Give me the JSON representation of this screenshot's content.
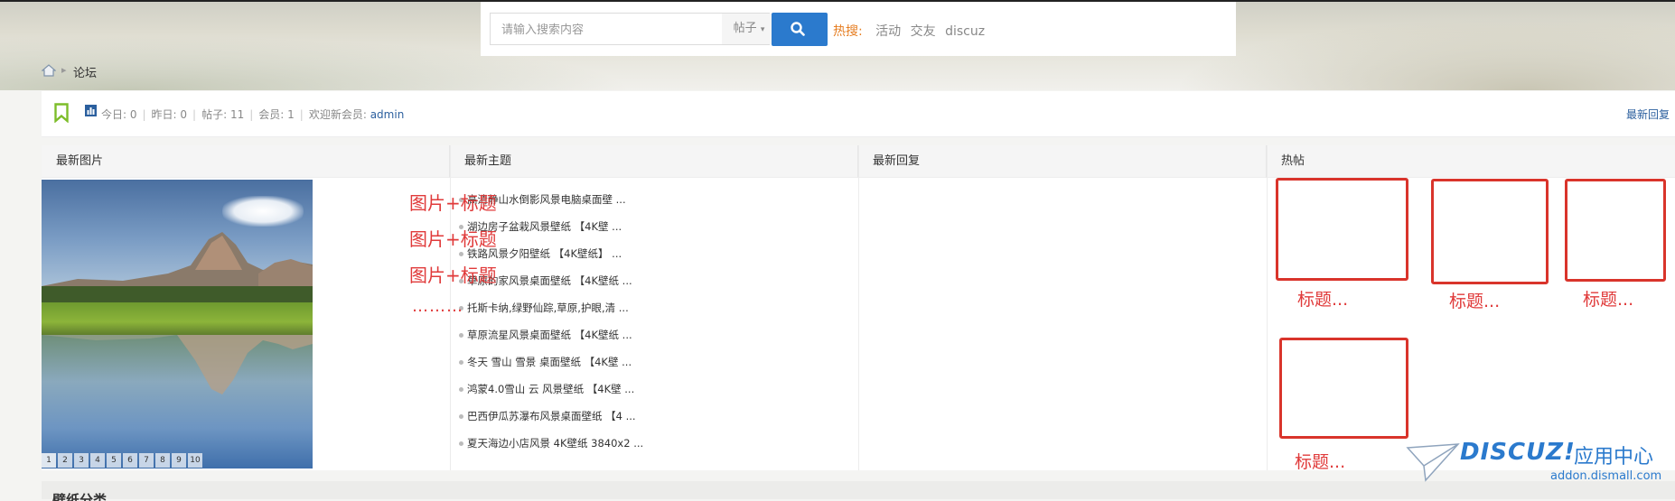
{
  "search": {
    "placeholder": "请输入搜索内容",
    "type_label": "帖子",
    "hot_label": "热搜:",
    "hot_links": [
      "活动",
      "交友",
      "discuz"
    ]
  },
  "breadcrumb": {
    "label": "论坛"
  },
  "stats": {
    "today": "今日: 0",
    "yesterday": "昨日: 0",
    "posts": "帖子: 11",
    "members": "会员: 1",
    "welcome_prefix": "欢迎新会员:",
    "new_member": "admin",
    "latest_reply_link": "最新回复"
  },
  "columns": {
    "latest_images": "最新图片",
    "latest_threads": "最新主题",
    "latest_replies": "最新回复",
    "hot_threads": "热帖"
  },
  "slideshow_pages": [
    "1",
    "2",
    "3",
    "4",
    "5",
    "6",
    "7",
    "8",
    "9",
    "10"
  ],
  "annotations": {
    "image_title_1": "图片+标题",
    "image_title_2": "图片+标题",
    "image_title_3": "图片+标题",
    "ellipsis": "………",
    "box_label": "标题..."
  },
  "threads": [
    "高清静山水倒影风景电脑桌面壁 ...",
    "湖边房子盆栽风景壁纸 【4K壁 ...",
    "铁路风景夕阳壁纸 【4K壁纸】 ...",
    "草原的家风景桌面壁纸 【4K壁纸 ...",
    "托斯卡纳,绿野仙踪,草原,护眼,清 ...",
    "草原流星风景桌面壁纸 【4K壁纸 ...",
    "冬天 雪山 雪景 桌面壁纸 【4K壁 ...",
    "鸿蒙4.0雪山 云 风景壁纸 【4K壁 ...",
    "巴西伊瓜苏瀑布风景桌面壁纸 【4 ...",
    "夏天海边小店风景 4K壁纸 3840x2 ..."
  ],
  "bottom": {
    "section_title": "壁纸分类"
  },
  "watermark": {
    "brand": "DISCUZ!",
    "center": "应用中心",
    "url": "addon.dismall.com"
  },
  "colors": {
    "accent": "#2b7acd",
    "annotation_red": "#d9342b",
    "hot_label": "#e67e22"
  }
}
